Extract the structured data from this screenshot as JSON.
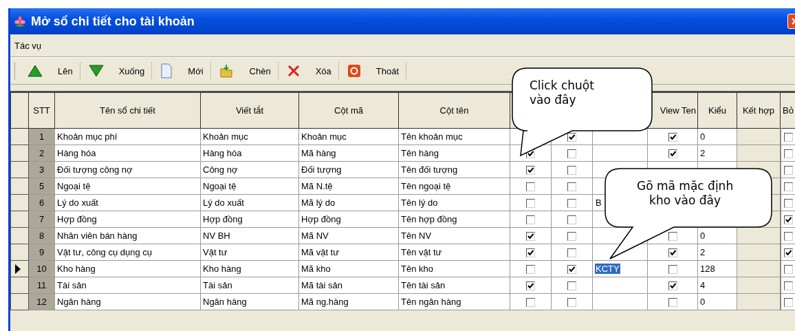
{
  "window": {
    "title": "Mở sổ chi tiết cho tài khoản"
  },
  "menu": [
    "Tác vụ"
  ],
  "toolbar": [
    {
      "kind": "up",
      "label": "Lên"
    },
    {
      "kind": "down",
      "label": "Xuống"
    },
    {
      "kind": "new",
      "label": "Mới"
    },
    {
      "kind": "insert",
      "label": "Chèn"
    },
    {
      "kind": "delete",
      "label": "Xóa"
    },
    {
      "kind": "exit",
      "label": "Thoát"
    }
  ],
  "table": {
    "columns": [
      "STT",
      "Tên sổ chi tiết",
      "Viết tắt",
      "Cột mã",
      "Cột tên",
      "View Ten",
      "Kiểu",
      "Kết hợp",
      "Bỏ"
    ],
    "rows": [
      {
        "selected": false,
        "stt": "1",
        "name": "Khoản mục phí",
        "abbr": "Khoản mục",
        "code_col": "Khoản mục",
        "name_col": "Tên khoản mục",
        "col_8": true,
        "view_ten": true,
        "kieu": "0",
        "bo": false
      },
      {
        "selected": false,
        "stt": "2",
        "name": "Hàng hóa",
        "abbr": "Hàng hóa",
        "code_col": "Mã hàng",
        "name_col": "Tên hàng",
        "col_7": true,
        "col_8": false,
        "view_ten": true,
        "kieu": "2",
        "bo": false
      },
      {
        "selected": false,
        "stt": "3",
        "name": "Đối tượng công nợ",
        "abbr": "Công nợ",
        "code_col": "Đối tượng",
        "name_col": "Tên đối tượng",
        "col_7": true,
        "col_8": false,
        "bo": false
      },
      {
        "selected": false,
        "stt": "5",
        "name": "Ngoại tệ",
        "abbr": "Ngoại tệ",
        "code_col": "Mã N.tệ",
        "name_col": "Tên ngoại tệ",
        "col_7": false,
        "col_8": false,
        "bo": false
      },
      {
        "selected": false,
        "stt": "6",
        "name": "Lý do xuất",
        "abbr": "Lý do xuất",
        "code_col": "Mã lý do",
        "name_col": "Tên lý do",
        "col_7": false,
        "col_8": false,
        "col_9": "B",
        "col_9_selected": false,
        "bo": false
      },
      {
        "selected": false,
        "stt": "7",
        "name": "Hợp đồng",
        "abbr": "Hợp đồng",
        "code_col": "Hợp đồng",
        "name_col": "Tên hợp đồng",
        "col_7": false,
        "col_8": false,
        "bo": true
      },
      {
        "selected": false,
        "stt": "8",
        "name": "Nhân viên bán hàng",
        "abbr": "NV BH",
        "code_col": "Mã NV",
        "name_col": "Tên NV",
        "col_7": true,
        "col_8": false,
        "view_ten": false,
        "kieu": "0",
        "bo": false
      },
      {
        "selected": false,
        "stt": "9",
        "name": "Vật tư, công cụ dụng cụ",
        "abbr": "Vật tư",
        "code_col": "Mã vật tư",
        "name_col": "Tên vật tư",
        "col_7": true,
        "col_8": false,
        "view_ten": true,
        "kieu": "2",
        "bo": true
      },
      {
        "selected": true,
        "stt": "10",
        "name": "Kho hàng",
        "abbr": "Kho hàng",
        "code_col": "Mã kho",
        "name_col": "Tên kho",
        "col_7": false,
        "col_8": true,
        "col_9": "KCTY",
        "col_9_selected": true,
        "view_ten": false,
        "kieu": "128",
        "bo": false
      },
      {
        "selected": false,
        "stt": "11",
        "name": "Tài sản",
        "abbr": "Tài sản",
        "code_col": "Mã tài sản",
        "name_col": "Tên tài sản",
        "col_7": true,
        "col_8": false,
        "view_ten": true,
        "kieu": "4",
        "bo": false
      },
      {
        "selected": false,
        "stt": "12",
        "name": "Ngân hàng",
        "abbr": "Ngân hàng",
        "code_col": "Mã ng.hàng",
        "name_col": "Tên ngân hàng",
        "col_7": false,
        "col_8": false,
        "view_ten": false,
        "kieu": "0",
        "bo": false
      }
    ]
  },
  "callouts": [
    "Click chuột\nvào đây",
    "Gõ mã mặc định\nkho vào đây"
  ]
}
